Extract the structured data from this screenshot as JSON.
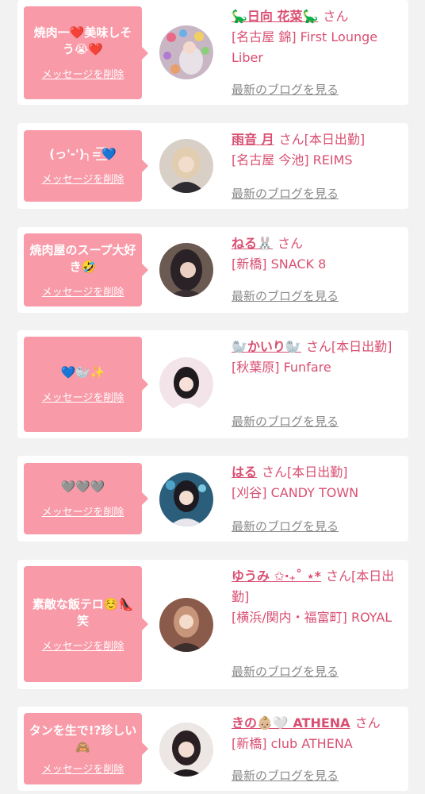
{
  "delete_label": "メッセージを削除",
  "blog_label": "最新のブログを見る",
  "san_label": "さん",
  "cards": [
    {
      "message": "焼肉一❤️美味しそう😭❤️",
      "name": "🦕日向 花菜🦕",
      "suffix": "",
      "shop": "[名古屋 錦] First Lounge Liber"
    },
    {
      "message": "(っ'-')╮=͟͟͞͞💙",
      "name": "雨音 月",
      "suffix": "[本日出勤]",
      "shop": "[名古屋 今池] REIMS"
    },
    {
      "message": "焼肉屋のスープ大好き🤣",
      "name": "ねる🐰",
      "suffix": "",
      "shop": "[新橋] SNACK 8"
    },
    {
      "message": "💙🦭✨",
      "name": "🦭かいり🦭",
      "suffix": "[本日出勤]",
      "shop": "[秋葉原] Funfare"
    },
    {
      "message": "🩶🩶🩶",
      "name": "はる",
      "suffix": "[本日出勤]",
      "shop": "[刈谷] CANDY TOWN"
    },
    {
      "message": "素敵な飯テロ☺️👠笑",
      "name": "ゆうみ ✩‧₊˚ ⋆*",
      "suffix": "[本日出勤]",
      "shop": "[横浜/関内・福富町] ROYAL"
    },
    {
      "message": "タンを生で!?珍しい🙈",
      "name": "きの👶🏼🤍 ATHENA",
      "suffix": "",
      "shop": "[新橋] club ATHENA"
    }
  ],
  "colors": {
    "bubble": "#f89aa8",
    "accent": "#d94f72",
    "muted": "#8a8a8a",
    "background": "#f2f2f2"
  }
}
